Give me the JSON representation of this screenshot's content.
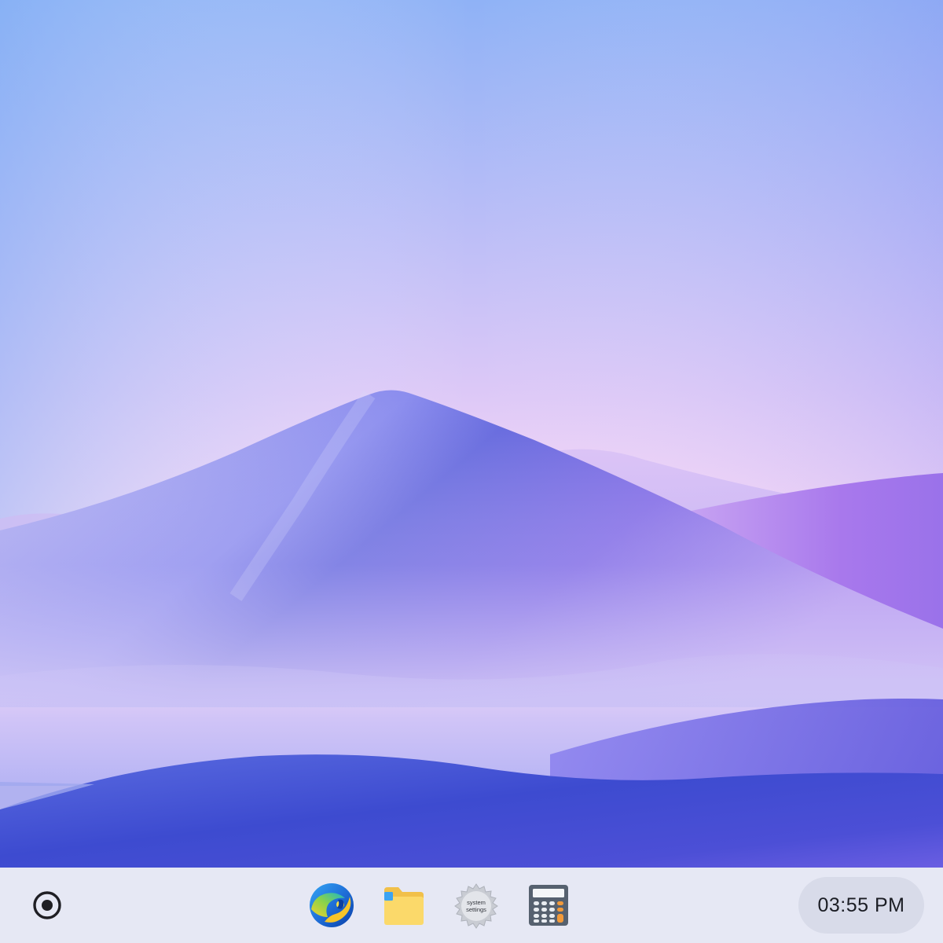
{
  "taskbar": {
    "launcher_icon": "launcher-circle-icon",
    "apps": [
      {
        "id": "browser",
        "icon": "browser-icon"
      },
      {
        "id": "files",
        "icon": "folder-icon"
      },
      {
        "id": "settings",
        "icon": "gear-icon",
        "label_line1": "system",
        "label_line2": "settings"
      },
      {
        "id": "calculator",
        "icon": "calculator-icon"
      }
    ],
    "clock": {
      "time": "03:55 PM"
    }
  },
  "colors": {
    "taskbar_bg": "#e6e8f4",
    "clock_pill_bg": "#d8dbe9",
    "sky_top": "#8fb4f6",
    "sky_horizon": "#fbd9f6",
    "dune_main": "#5e62dc",
    "dune_front": "#3f4ad0"
  }
}
